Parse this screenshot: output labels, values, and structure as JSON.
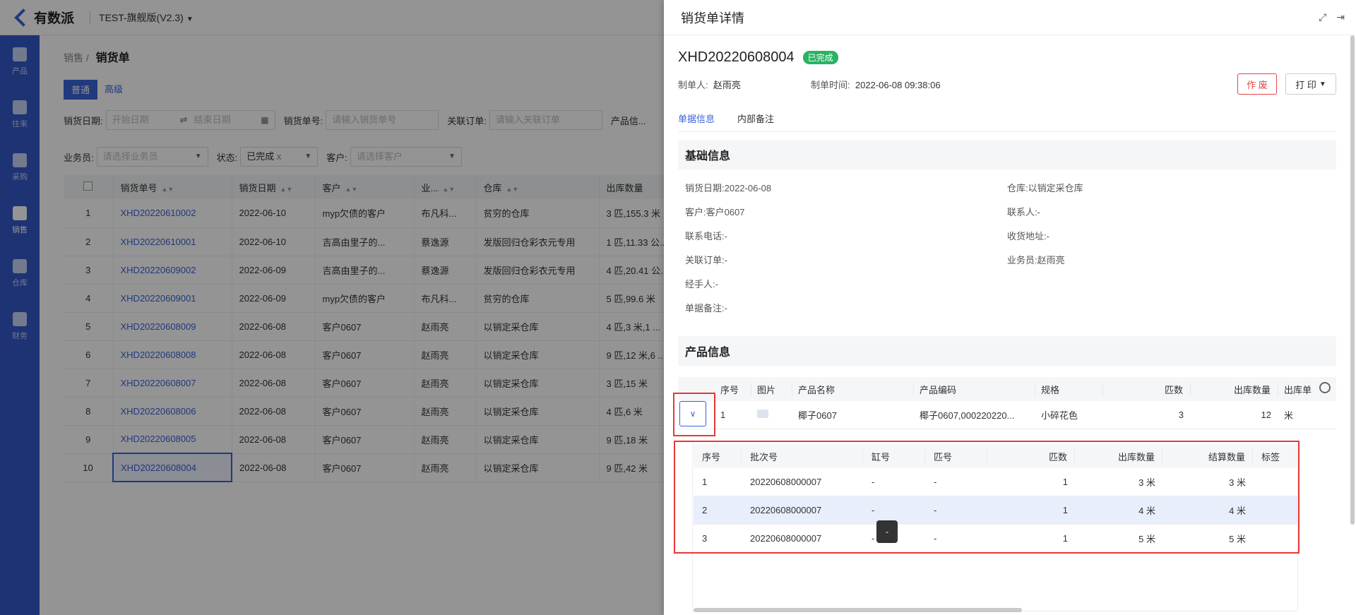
{
  "app": {
    "logo": "有数派",
    "version": "TEST-旗舰版(V2.3)"
  },
  "sidebar": [
    {
      "label": "产品",
      "icon": "product-icon"
    },
    {
      "label": "往来",
      "icon": "contacts-icon"
    },
    {
      "label": "采购",
      "icon": "purchase-icon"
    },
    {
      "label": "销售",
      "icon": "sales-icon",
      "active": true
    },
    {
      "label": "仓库",
      "icon": "warehouse-icon"
    },
    {
      "label": "财务",
      "icon": "finance-icon"
    }
  ],
  "breadcrumb": {
    "parent": "销售",
    "current": "销货单"
  },
  "mode_tabs": [
    "普通",
    "高级"
  ],
  "filters": {
    "date_label": "销货日期:",
    "start_placeholder": "开始日期",
    "end_placeholder": "结束日期",
    "order_no_label": "销货单号:",
    "order_no_placeholder": "请输入销货单号",
    "related_label": "关联订单:",
    "related_placeholder": "请输入关联订单",
    "product_label": "产品信...",
    "salesman_label": "业务员:",
    "salesman_placeholder": "请选择业务员",
    "status_label": "状态:",
    "status_value": "已完成",
    "status_clear": "x",
    "customer_label": "客户:",
    "customer_placeholder": "请选择客户"
  },
  "table": {
    "headers": [
      "销货单号",
      "销货日期",
      "客户",
      "业...",
      "仓库",
      "出库数量"
    ],
    "rows": [
      {
        "idx": "1",
        "no": "XHD20220610002",
        "date": "2022-06-10",
        "customer": "myp欠债的客户",
        "salesman": "布凡科...",
        "warehouse": "贫穷的仓库",
        "qty": "3 匹,155.3 米"
      },
      {
        "idx": "2",
        "no": "XHD20220610001",
        "date": "2022-06-10",
        "customer": "吉高由里子的...",
        "salesman": "蔡逸源",
        "warehouse": "发版回归仓彩衣元专用",
        "qty": "1 匹,11.33 公..."
      },
      {
        "idx": "3",
        "no": "XHD20220609002",
        "date": "2022-06-09",
        "customer": "吉高由里子的...",
        "salesman": "蔡逸源",
        "warehouse": "发版回归仓彩衣元专用",
        "qty": "4 匹,20.41 公..."
      },
      {
        "idx": "4",
        "no": "XHD20220609001",
        "date": "2022-06-09",
        "customer": "myp欠债的客户",
        "salesman": "布凡科...",
        "warehouse": "贫穷的仓库",
        "qty": "5 匹,99.6 米"
      },
      {
        "idx": "5",
        "no": "XHD20220608009",
        "date": "2022-06-08",
        "customer": "客户0607",
        "salesman": "赵雨亮",
        "warehouse": "以销定采仓库",
        "qty": "4 匹,3 米,1 ..."
      },
      {
        "idx": "6",
        "no": "XHD20220608008",
        "date": "2022-06-08",
        "customer": "客户0607",
        "salesman": "赵雨亮",
        "warehouse": "以销定采仓库",
        "qty": "9 匹,12 米,6 ..."
      },
      {
        "idx": "7",
        "no": "XHD20220608007",
        "date": "2022-06-08",
        "customer": "客户0607",
        "salesman": "赵雨亮",
        "warehouse": "以销定采仓库",
        "qty": "3 匹,15 米"
      },
      {
        "idx": "8",
        "no": "XHD20220608006",
        "date": "2022-06-08",
        "customer": "客户0607",
        "salesman": "赵雨亮",
        "warehouse": "以销定采仓库",
        "qty": "4 匹,6 米"
      },
      {
        "idx": "9",
        "no": "XHD20220608005",
        "date": "2022-06-08",
        "customer": "客户0607",
        "salesman": "赵雨亮",
        "warehouse": "以销定采仓库",
        "qty": "9 匹,18 米"
      },
      {
        "idx": "10",
        "no": "XHD20220608004",
        "date": "2022-06-08",
        "customer": "客户0607",
        "salesman": "赵雨亮",
        "warehouse": "以销定采仓库",
        "qty": "9 匹,42 米"
      }
    ]
  },
  "drawer": {
    "title": "销货单详情",
    "doc_no": "XHD20220608004",
    "status": "已完成",
    "maker_label": "制单人:",
    "maker": "赵雨亮",
    "time_label": "制单时间:",
    "time": "2022-06-08 09:38:06",
    "void_button": "作 废",
    "print_button": "打 印",
    "tabs": [
      "单据信息",
      "内部备注"
    ],
    "basic_title": "基础信息",
    "basic": {
      "date": "销货日期:2022-06-08",
      "warehouse": "仓库:以销定采仓库",
      "customer": "客户:客户0607",
      "contact": "联系人:-",
      "phone": "联系电话:-",
      "address": "收货地址:-",
      "related": "关联订单:-",
      "salesman": "业务员:赵雨亮",
      "handler": "经手人:-",
      "remark": "单据备注:-"
    },
    "product_title": "产品信息",
    "product_headers": [
      "序号",
      "图片",
      "产品名称",
      "产品编码",
      "规格",
      "匹数",
      "出库数量",
      "出库单"
    ],
    "product_row": {
      "idx": "1",
      "name": "椰子0607",
      "code": "椰子0607,000220220...",
      "spec": "小碎花色",
      "pieces": "3",
      "qty": "12",
      "unit": "米"
    },
    "sub_headers": [
      "序号",
      "批次号",
      "缸号",
      "匹号",
      "匹数",
      "出库数量",
      "结算数量",
      "标签"
    ],
    "sub_rows": [
      {
        "idx": "1",
        "batch": "20220608000007",
        "vat": "-",
        "piece_no": "-",
        "pieces": "1",
        "qty": "3 米",
        "settle": "3 米"
      },
      {
        "idx": "2",
        "batch": "20220608000007",
        "vat": "-",
        "piece_no": "-",
        "pieces": "1",
        "qty": "4 米",
        "settle": "4 米"
      },
      {
        "idx": "3",
        "batch": "20220608000007",
        "vat": "-",
        "piece_no": "-",
        "pieces": "1",
        "qty": "5 米",
        "settle": "5 米"
      }
    ],
    "tooltip": "-"
  }
}
